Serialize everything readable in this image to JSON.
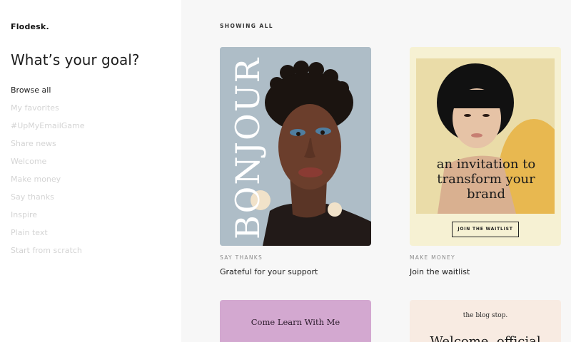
{
  "sidebar": {
    "logo": "Flodesk.",
    "title": "What’s your goal?",
    "items": [
      {
        "label": "Browse all",
        "active": true
      },
      {
        "label": "My favorites"
      },
      {
        "label": "#UpMyEmailGame"
      },
      {
        "label": "Share news"
      },
      {
        "label": "Welcome"
      },
      {
        "label": "Make money"
      },
      {
        "label": "Say thanks"
      },
      {
        "label": "Inspire"
      },
      {
        "label": "Plain text"
      },
      {
        "label": "Start from scratch"
      }
    ]
  },
  "main": {
    "filter_label": "SHOWING ALL",
    "cards": [
      {
        "category": "SAY THANKS",
        "title": "Grateful for your support",
        "thumb_text": "BONJOUR",
        "thumb_bg": "#aebdc7"
      },
      {
        "category": "MAKE MONEY",
        "title": "Join the waitlist",
        "thumb_text": "an invitation to transform your brand",
        "button": "JOIN THE WAITLIST",
        "thumb_bg": "#f6f1d3"
      },
      {
        "thumb_text": "Come Learn With Me",
        "thumb_bg": "#d3a8d0"
      },
      {
        "thumb_text_small": "the blog stop.",
        "thumb_text": "Welcome, official",
        "thumb_bg": "#f8ebe2"
      }
    ]
  },
  "colors": {
    "sidebar_bg": "#ffffff",
    "page_bg": "#f7f7f7",
    "active_nav": "#1d1d1d",
    "inactive_nav": "#d4d4d4"
  }
}
